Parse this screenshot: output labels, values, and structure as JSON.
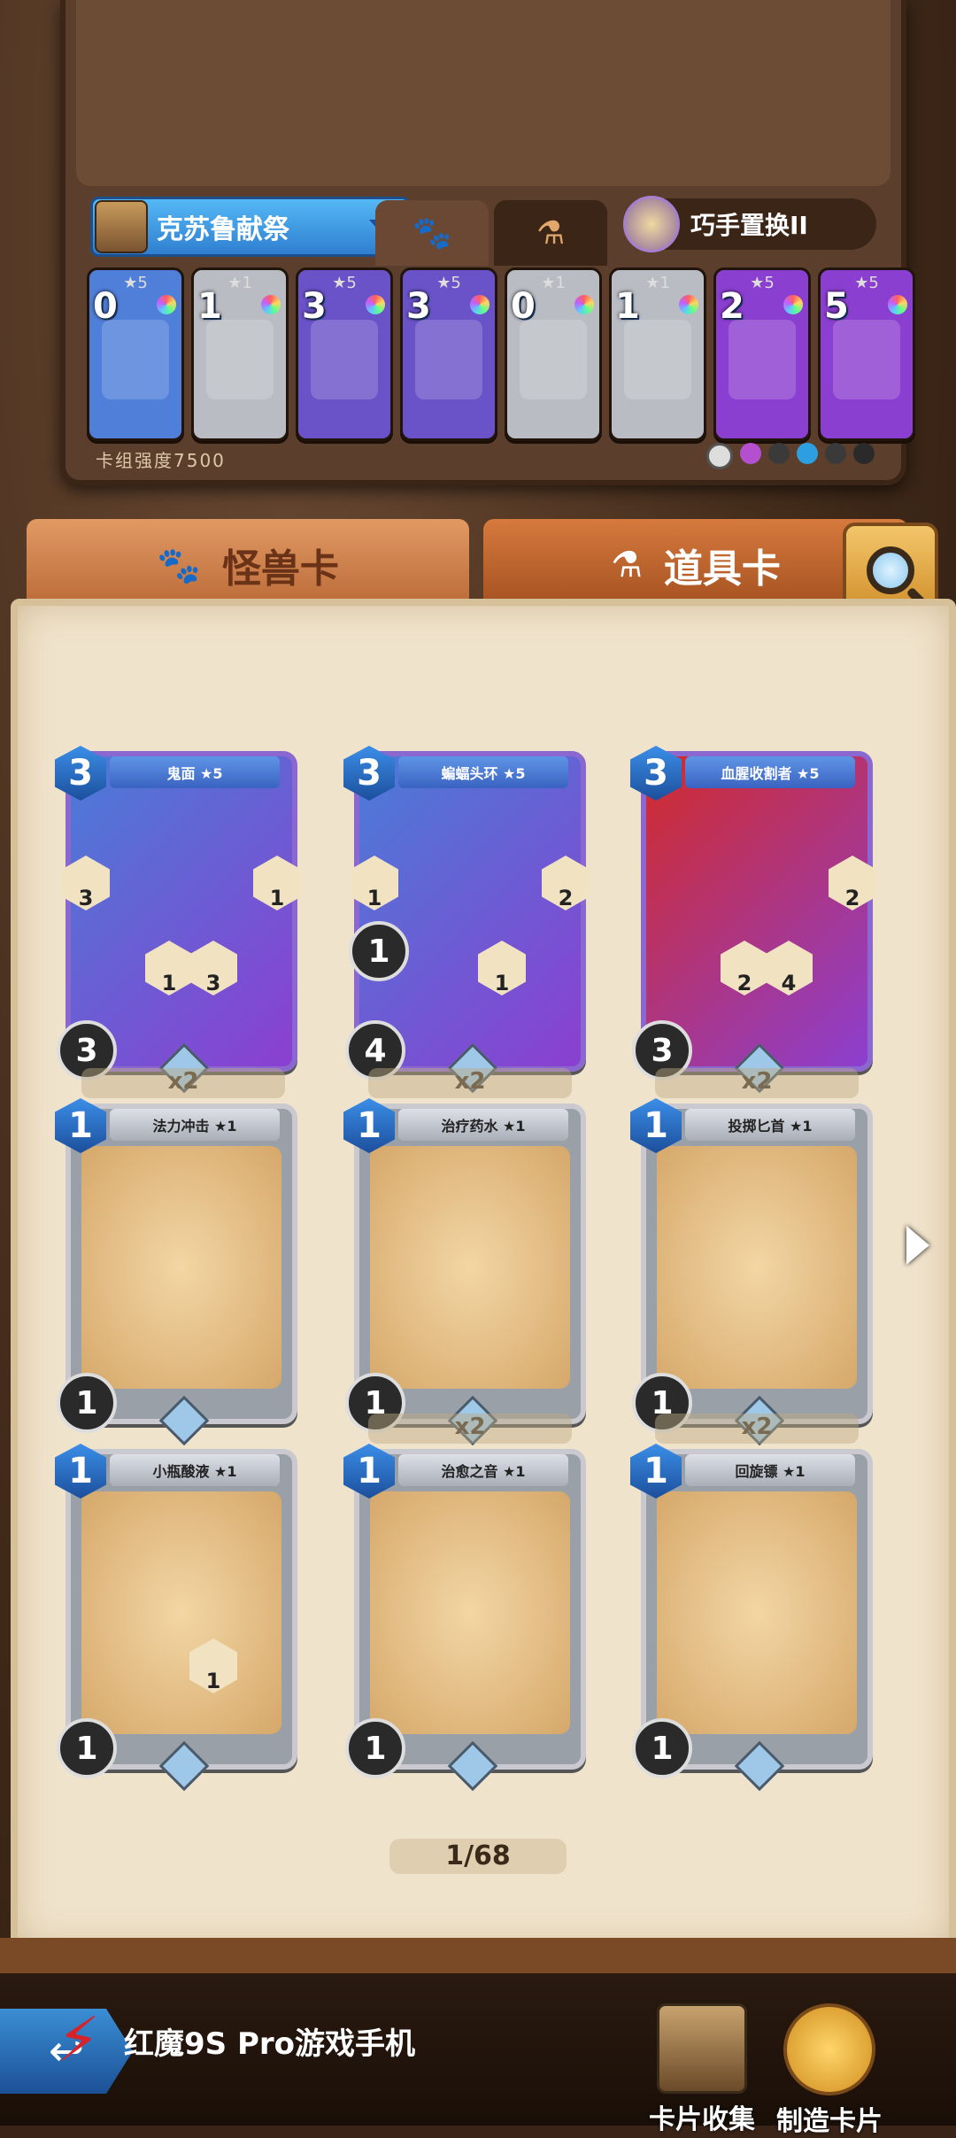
{
  "deck": {
    "name": "克苏鲁献祭",
    "skill": "巧手置换II",
    "strength_label": "卡组强度7500",
    "mini_cards": [
      {
        "cost": "0",
        "stars": "★5",
        "color": "#4f7fd9"
      },
      {
        "cost": "1",
        "stars": "★1",
        "color": "#b9bcc3"
      },
      {
        "cost": "3",
        "stars": "★5",
        "color": "#6a52c9"
      },
      {
        "cost": "3",
        "stars": "★5",
        "color": "#6a52c9"
      },
      {
        "cost": "0",
        "stars": "★1",
        "color": "#b9bcc3"
      },
      {
        "cost": "1",
        "stars": "★1",
        "color": "#b9bcc3"
      },
      {
        "cost": "2",
        "stars": "★5",
        "color": "#8b3fd0"
      },
      {
        "cost": "5",
        "stars": "★5",
        "color": "#8b3fd0"
      }
    ]
  },
  "tabs": {
    "monster": "怪兽卡",
    "item": "道具卡"
  },
  "cards": [
    {
      "name": "鬼面 ★5",
      "cost": "3",
      "stat": "3",
      "badge_l": "3",
      "badge_r": "1",
      "c1": "1",
      "c2": "3",
      "mid": "",
      "rarity": "epic"
    },
    {
      "name": "蝙蝠头环 ★5",
      "cost": "3",
      "stat": "4",
      "badge_l": "1",
      "badge_r": "2",
      "c1": "",
      "c2": "1",
      "mid": "1",
      "rarity": "epic"
    },
    {
      "name": "血腥收割者 ★5",
      "cost": "3",
      "stat": "3",
      "badge_l": "",
      "badge_r": "2",
      "c1": "2",
      "c2": "4",
      "mid": "",
      "rarity": "epic-red"
    },
    {
      "name": "法力冲击 ★1",
      "cost": "1",
      "stat": "1",
      "rarity": "common"
    },
    {
      "name": "治疗药水 ★1",
      "cost": "1",
      "stat": "1",
      "rarity": "common"
    },
    {
      "name": "投掷匕首 ★1",
      "cost": "1",
      "stat": "1",
      "rarity": "common"
    },
    {
      "name": "小瓶酸液 ★1",
      "cost": "1",
      "stat": "1",
      "c2": "1",
      "rarity": "common"
    },
    {
      "name": "治愈之音 ★1",
      "cost": "1",
      "stat": "1",
      "rarity": "common"
    },
    {
      "name": "回旋镖 ★1",
      "cost": "1",
      "stat": "1",
      "rarity": "common"
    }
  ],
  "multiplier": "x2",
  "pager": "1/68",
  "bottom": {
    "brand": "红魔9S Pro游戏手机",
    "collection": "卡片收集",
    "craft": "制造卡片"
  }
}
